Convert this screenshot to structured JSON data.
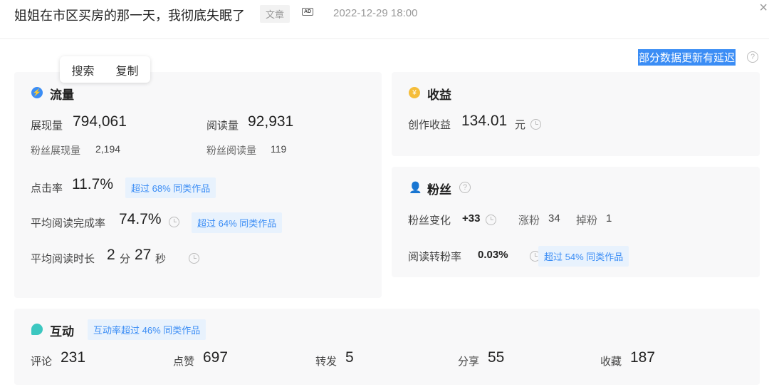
{
  "header": {
    "title": "姐姐在市区买房的那一天，我彻底失眠了",
    "tag": "文章",
    "ad": "AD",
    "date": "2022-12-29 18:00",
    "close": "×"
  },
  "notice": {
    "text": "部分数据更新有延迟",
    "help": "?"
  },
  "popup": {
    "search": "搜索",
    "copy": "复制"
  },
  "traffic": {
    "title": "流量",
    "impressions_label": "展现量",
    "impressions": "794,061",
    "reads_label": "阅读量",
    "reads": "92,931",
    "fan_impr_label": "粉丝展现量",
    "fan_impr": "2,194",
    "fan_reads_label": "粉丝阅读量",
    "fan_reads": "119",
    "ctr_label": "点击率",
    "ctr": "11.7%",
    "ctr_badge": "超过 68% 同类作品",
    "completion_label": "平均阅读完成率",
    "completion": "74.7%",
    "completion_badge": "超过 64% 同类作品",
    "duration_label": "平均阅读时长",
    "dur_min": "2",
    "min_unit": "分",
    "dur_sec": "27",
    "sec_unit": "秒"
  },
  "income": {
    "title": "收益",
    "label": "创作收益",
    "value": "134.01",
    "unit": "元",
    "icon_glyph": "¥"
  },
  "fans": {
    "title": "粉丝",
    "change_label": "粉丝变化",
    "change": "+33",
    "gain_label": "涨粉",
    "gain": "34",
    "loss_label": "掉粉",
    "loss": "1",
    "conv_label": "阅读转粉率",
    "conv": "0.03%",
    "conv_badge": "超过 54% 同类作品"
  },
  "interaction": {
    "title": "互动",
    "badge": "互动率超过 46% 同类作品",
    "items": [
      {
        "label": "评论",
        "value": "231"
      },
      {
        "label": "点赞",
        "value": "697"
      },
      {
        "label": "转发",
        "value": "5"
      },
      {
        "label": "分享",
        "value": "55"
      },
      {
        "label": "收藏",
        "value": "187"
      }
    ]
  }
}
